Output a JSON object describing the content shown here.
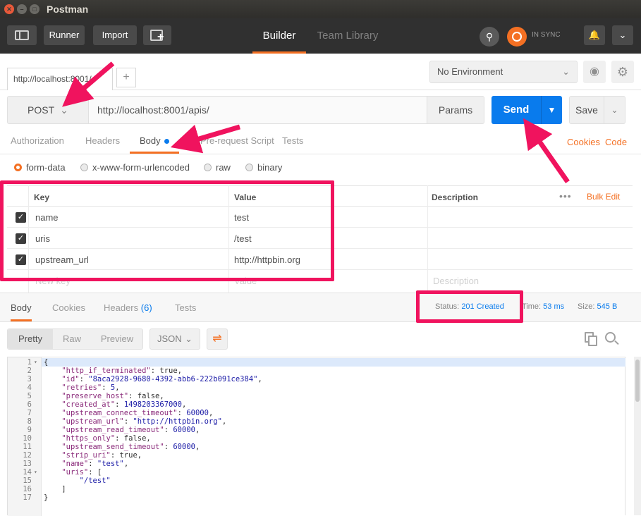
{
  "window": {
    "title": "Postman"
  },
  "header": {
    "runner_label": "Runner",
    "import_label": "Import",
    "tabs": [
      {
        "label": "Builder",
        "active": true
      },
      {
        "label": "Team Library",
        "active": false
      }
    ],
    "sync_label": "IN SYNC"
  },
  "tabs": {
    "request_tab_label": "http://localhost:8001/",
    "add_tab": "+"
  },
  "environment": {
    "selected": "No Environment"
  },
  "request": {
    "method": "POST",
    "url": "http://localhost:8001/apis/",
    "params_label": "Params",
    "send_label": "Send",
    "save_label": "Save"
  },
  "request_tabs": {
    "authorization": "Authorization",
    "headers": "Headers",
    "body": "Body",
    "prerequest": "Pre-request Script",
    "tests": "Tests",
    "cookies": "Cookies",
    "code": "Code"
  },
  "body_types": {
    "form_data": "form-data",
    "urlencoded": "x-www-form-urlencoded",
    "raw": "raw",
    "binary": "binary",
    "selected": "form-data"
  },
  "kv_table": {
    "headers": {
      "key": "Key",
      "value": "Value",
      "description": "Description"
    },
    "bulk_edit": "Bulk Edit",
    "rows": [
      {
        "key": "name",
        "value": "test",
        "checked": true
      },
      {
        "key": "uris",
        "value": "/test",
        "checked": true
      },
      {
        "key": "upstream_url",
        "value": "http://httpbin.org",
        "checked": true
      }
    ],
    "placeholder": {
      "key": "New key",
      "value": "Value",
      "description": "Description"
    }
  },
  "response": {
    "tabs": {
      "body": "Body",
      "cookies": "Cookies",
      "headers": "Headers",
      "headers_count": "(6)",
      "tests": "Tests"
    },
    "status_label": "Status:",
    "status_value": "201 Created",
    "time_label": "Time:",
    "time_value": "53 ms",
    "size_label": "Size:",
    "size_value": "545 B",
    "formats": {
      "pretty": "Pretty",
      "raw": "Raw",
      "preview": "Preview"
    },
    "language": "JSON",
    "lines": [
      "{",
      "    \"http_if_terminated\": true,",
      "    \"id\": \"8aca2928-9680-4392-abb6-222b091ce384\",",
      "    \"retries\": 5,",
      "    \"preserve_host\": false,",
      "    \"created_at\": 1498203367000,",
      "    \"upstream_connect_timeout\": 60000,",
      "    \"upstream_url\": \"http://httpbin.org\",",
      "    \"upstream_read_timeout\": 60000,",
      "    \"https_only\": false,",
      "    \"upstream_send_timeout\": 60000,",
      "    \"strip_uri\": true,",
      "    \"name\": \"test\",",
      "    \"uris\": [",
      "        \"/test\"",
      "    ]",
      "}"
    ]
  },
  "colors": {
    "accent": "#f47023",
    "send_blue": "#097bed",
    "annotation": "#f0135e"
  }
}
